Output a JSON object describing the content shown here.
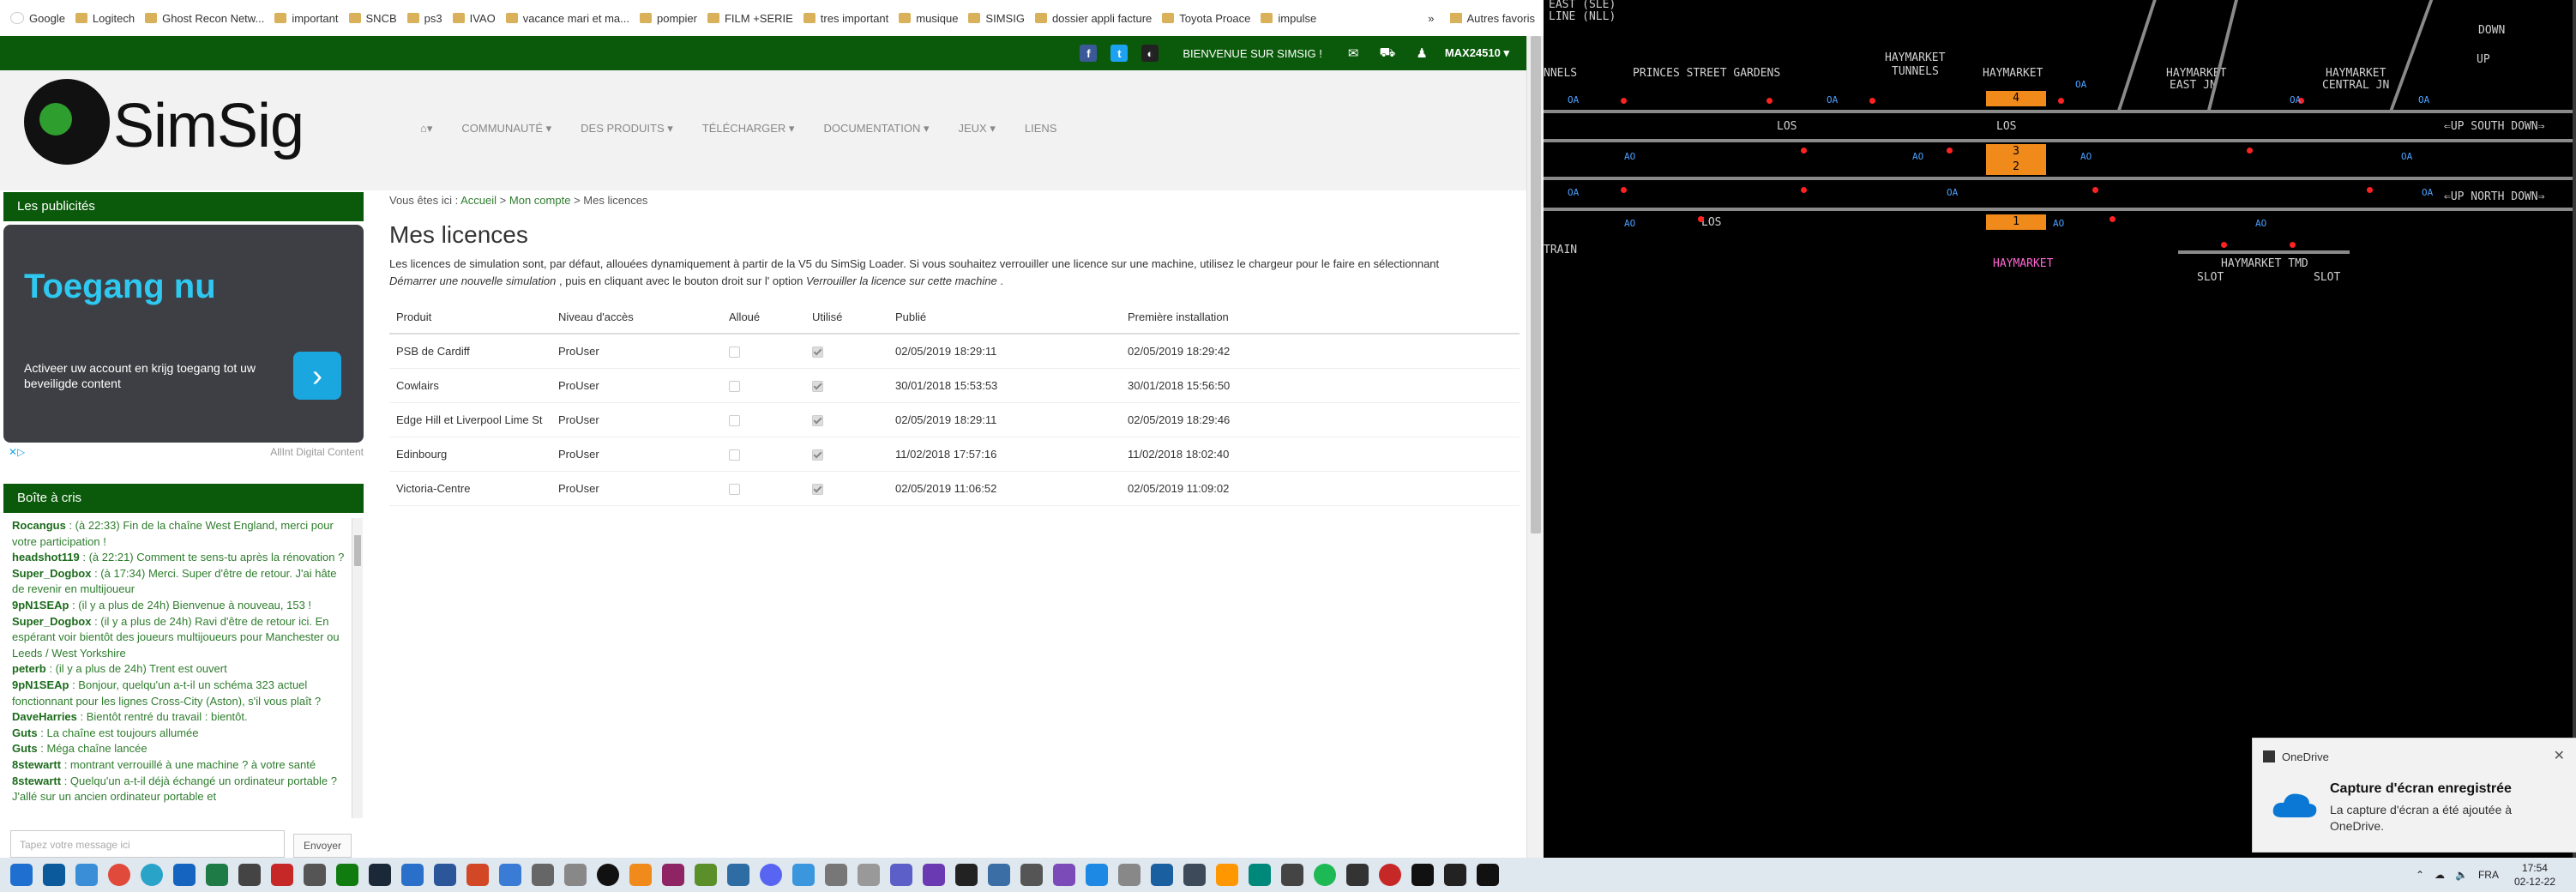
{
  "bookmarks": {
    "items": [
      "Google",
      "Logitech",
      "Ghost Recon Netw...",
      "important",
      "SNCB",
      "ps3",
      "IVAO",
      "vacance mari et ma...",
      "pompier",
      "FILM +SERIE",
      "tres important",
      "musique",
      "SIMSIG",
      "dossier appli facture",
      "Toyota Proace",
      "impulse"
    ],
    "more": "»",
    "other": "Autres favoris"
  },
  "topbar": {
    "welcome": "BIENVENUE SUR SIMSIG !",
    "user": "MAX24510 ▾"
  },
  "logo": {
    "text": "SimSig"
  },
  "nav": {
    "items": [
      "COMMUNAUTÉ ▾",
      "DES PRODUITS ▾",
      "TÉLÉCHARGER ▾",
      "DOCUMENTATION ▾",
      "JEUX ▾",
      "LIENS"
    ]
  },
  "ads": {
    "header": "Les publicités",
    "title": "Toegang nu",
    "text": "Activeer uw account en krijg toegang tot uw beveiligde content",
    "footer": "AllInt Digital Content"
  },
  "shoutbox": {
    "header": "Boîte à cris",
    "messages": [
      {
        "user": "Rocangus",
        "text": " : (à 22:33) Fin de la chaîne West England, merci pour votre participation !"
      },
      {
        "user": "headshot119",
        "text": " : (à 22:21) Comment te sens-tu après la rénovation ?"
      },
      {
        "user": "Super_Dogbox",
        "text": " : (à 17:34) Merci. Super d'être de retour. J'ai hâte de revenir en multijoueur"
      },
      {
        "user": "9pN1SEAp",
        "text": " : (il y a plus de 24h) Bienvenue à nouveau, 153 !"
      },
      {
        "user": "Super_Dogbox",
        "text": " : (il y a plus de 24h) Ravi d'être de retour ici. En espérant voir bientôt des joueurs multijoueurs pour Manchester ou Leeds / West Yorkshire"
      },
      {
        "user": "peterb",
        "text": " : (il y a plus de 24h) Trent est ouvert"
      },
      {
        "user": "9pN1SEAp",
        "text": " : Bonjour, quelqu'un a-t-il un schéma 323 actuel fonctionnant pour les lignes Cross-City (Aston), s'il vous plaît ?"
      },
      {
        "user": "DaveHarries",
        "text": " : Bientôt rentré du travail : bientôt."
      },
      {
        "user": "Guts",
        "text": " : La chaîne est toujours allumée"
      },
      {
        "user": "Guts",
        "text": " : Méga chaîne lancée"
      },
      {
        "user": "8stewartt",
        "text": " : montrant verrouillé à une machine ? à votre santé"
      },
      {
        "user": "8stewartt",
        "text": " : Quelqu'un a-t-il déjà échangé un ordinateur portable ? J'allé sur un ancien ordinateur portable et"
      }
    ],
    "placeholder": "Tapez votre message ici",
    "send": "Envoyer"
  },
  "breadcrumb": {
    "prefix": "Vous êtes ici :",
    "home": "Accueil",
    "sep1": ">",
    "account": "Mon compte",
    "sep2": ">",
    "current": "Mes licences"
  },
  "page": {
    "title": "Mes licences",
    "intro_1": "Les licences de simulation sont, par défaut, allouées dynamiquement à partir de la V5 du SimSig Loader. Si vous souhaitez verrouiller une licence sur une machine, utilisez le chargeur pour le faire en sélectionnant",
    "intro_em1": "Démarrer une nouvelle simulation",
    "intro_2": ", puis en cliquant avec le bouton droit sur l' option",
    "intro_em2": "Verrouiller la licence sur cette machine",
    "intro_3": "."
  },
  "licences": {
    "headers": [
      "Produit",
      "Niveau d'accès",
      "Alloué",
      "Utilisé",
      "Publié",
      "Première installation"
    ],
    "rows": [
      {
        "product": "PSB de Cardiff",
        "level": "ProUser",
        "published": "02/05/2019 18:29:11",
        "installed": "02/05/2019 18:29:42"
      },
      {
        "product": "Cowlairs",
        "level": "ProUser",
        "published": "30/01/2018 15:53:53",
        "installed": "30/01/2018 15:56:50"
      },
      {
        "product": "Edge Hill et Liverpool Lime St",
        "level": "ProUser",
        "published": "02/05/2019 18:29:11",
        "installed": "02/05/2019 18:29:46"
      },
      {
        "product": "Edinbourg",
        "level": "ProUser",
        "published": "11/02/2018 17:57:16",
        "installed": "11/02/2018 18:02:40"
      },
      {
        "product": "Victoria-Centre",
        "level": "ProUser",
        "published": "02/05/2019 11:06:52",
        "installed": "02/05/2019 11:09:02"
      }
    ]
  },
  "sim": {
    "labels": {
      "east": "EAST (SLE)",
      "line": "LINE (NLL)",
      "nnels": "NNELS",
      "gardens": "PRINCES STREET GARDENS",
      "tunnels_a": "HAYMARKET",
      "tunnels_b": "TUNNELS",
      "haymarket_top": "HAYMARKET",
      "east_jn_a": "HAYMARKET",
      "east_jn_b": "EAST JN",
      "central_a": "HAYMARKET",
      "central_b": "CENTRAL JN",
      "down": "DOWN",
      "up": "UP",
      "up_south": "⇐UP SOUTH DOWN⇒",
      "up_north": "⇐UP NORTH DOWN⇒",
      "los1": "LOS",
      "los2": "LOS",
      "los3": "LOS",
      "train": "TRAIN",
      "haymarket_station": "HAYMARKET",
      "tmd": "HAYMARKET TMD",
      "slot1": "SLOT",
      "slot2": "SLOT",
      "oa": "OA",
      "ao": "AO"
    },
    "platforms": [
      "4",
      "3",
      "2",
      "1"
    ]
  },
  "toast": {
    "app": "OneDrive",
    "title": "Capture d'écran enregistrée",
    "body": "La capture d'écran a été ajoutée à OneDrive.",
    "close": "✕"
  },
  "taskbar": {
    "lang": "FRA",
    "time": "17:54",
    "date": "02-12-22"
  },
  "colors": {
    "brand_green": "#0b5a0b",
    "accent": "#2ec8f0",
    "platform": "#f08a1a"
  }
}
